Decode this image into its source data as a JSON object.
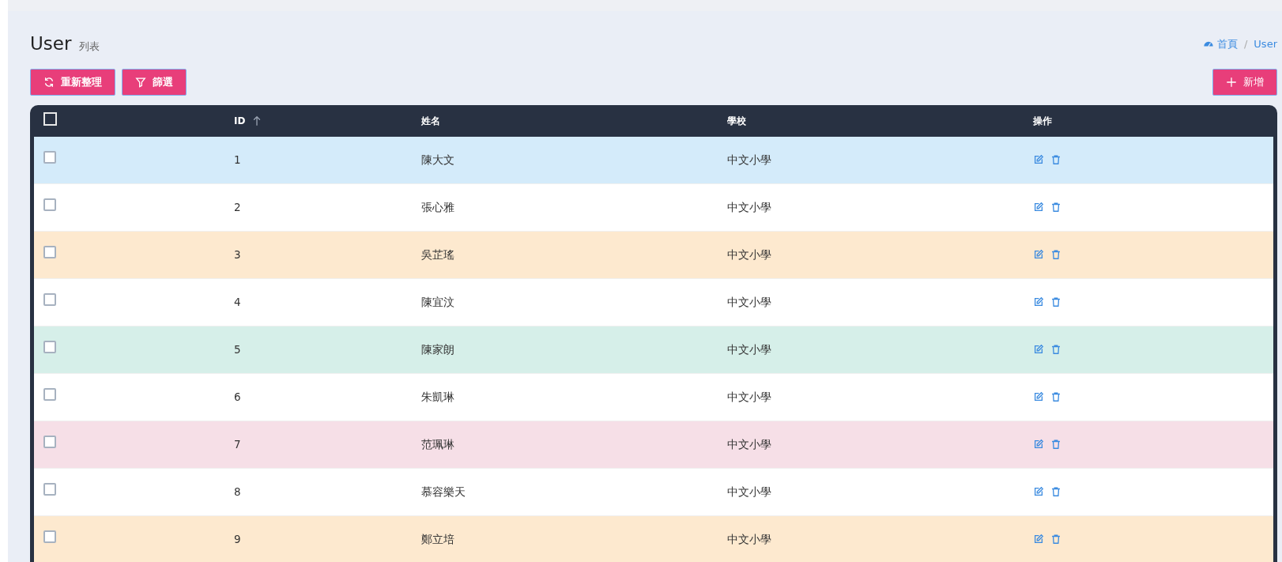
{
  "header": {
    "title": "User",
    "subtitle": "列表"
  },
  "breadcrumb_separator": "/",
  "breadcrumb": [
    {
      "label": "首頁",
      "kind": "home"
    },
    {
      "label": "User",
      "kind": "page"
    }
  ],
  "toolbar": [
    {
      "label": "重新整理",
      "kind": "refresh"
    },
    {
      "label": "篩選",
      "kind": "filter"
    }
  ],
  "add_button": {
    "label": "新增"
  },
  "table": {
    "select_all": {
      "checked": false
    },
    "columns": [
      {
        "label": "ID",
        "sorted_ascending": true
      },
      {
        "label": "姓名"
      },
      {
        "label": "學校"
      },
      {
        "label": "操作"
      }
    ],
    "rows": [
      {
        "checked": false,
        "color": "#d4ebfa",
        "id": "1",
        "name": "陳大文",
        "school": "中文小學"
      },
      {
        "checked": false,
        "color": "#ffffff",
        "id": "2",
        "name": "張心雅",
        "school": "中文小學"
      },
      {
        "checked": false,
        "color": "#fde9cf",
        "id": "3",
        "name": "吳芷瑤",
        "school": "中文小學"
      },
      {
        "checked": false,
        "color": "#ffffff",
        "id": "4",
        "name": "陳宜汶",
        "school": "中文小學"
      },
      {
        "checked": false,
        "color": "#d6efe9",
        "id": "5",
        "name": "陳家朗",
        "school": "中文小學"
      },
      {
        "checked": false,
        "color": "#ffffff",
        "id": "6",
        "name": "朱凱琳",
        "school": "中文小學"
      },
      {
        "checked": false,
        "color": "#f6dfe7",
        "id": "7",
        "name": "范珮琳",
        "school": "中文小學"
      },
      {
        "checked": false,
        "color": "#ffffff",
        "id": "8",
        "name": "慕容樂天",
        "school": "中文小學"
      },
      {
        "checked": false,
        "color": "#fde9cf",
        "id": "9",
        "name": "鄭立培",
        "school": "中文小學"
      }
    ]
  }
}
